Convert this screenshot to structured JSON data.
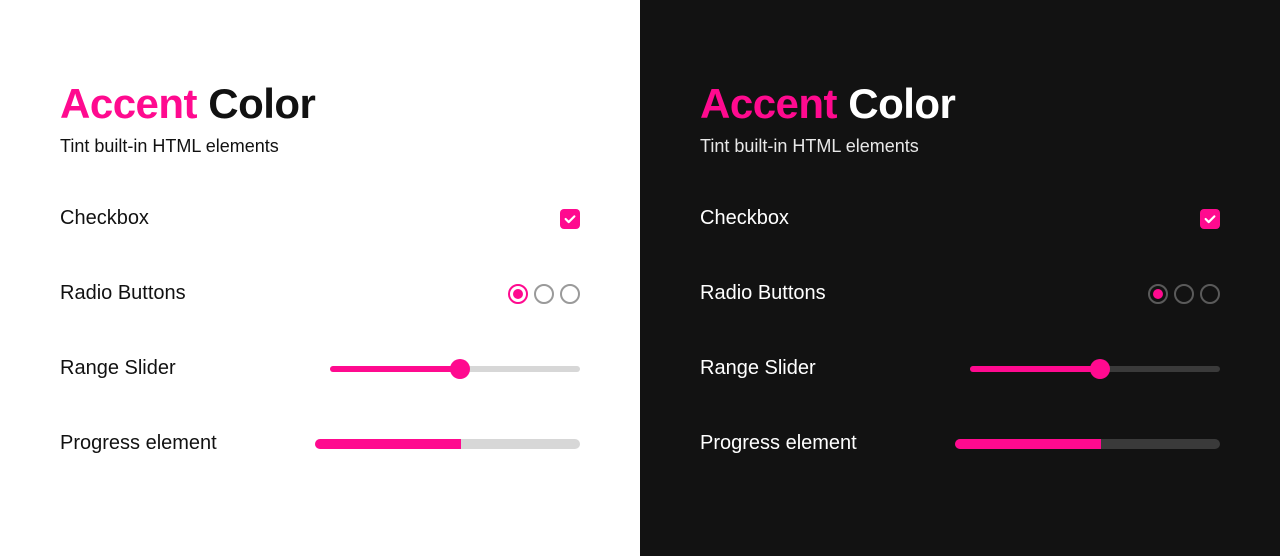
{
  "accent_color": "#ff0a8f",
  "header": {
    "title_accent": "Accent",
    "title_rest": " Color",
    "subtitle": "Tint built-in HTML elements"
  },
  "rows": {
    "checkbox_label": "Checkbox",
    "checkbox_checked": true,
    "radio_label": "Radio Buttons",
    "radio_selected_index": 0,
    "radio_count": 3,
    "range_label": "Range Slider",
    "range_value": 52,
    "range_min": 0,
    "range_max": 100,
    "progress_label": "Progress element",
    "progress_value": 55,
    "progress_max": 100
  },
  "themes": [
    "light",
    "dark"
  ]
}
